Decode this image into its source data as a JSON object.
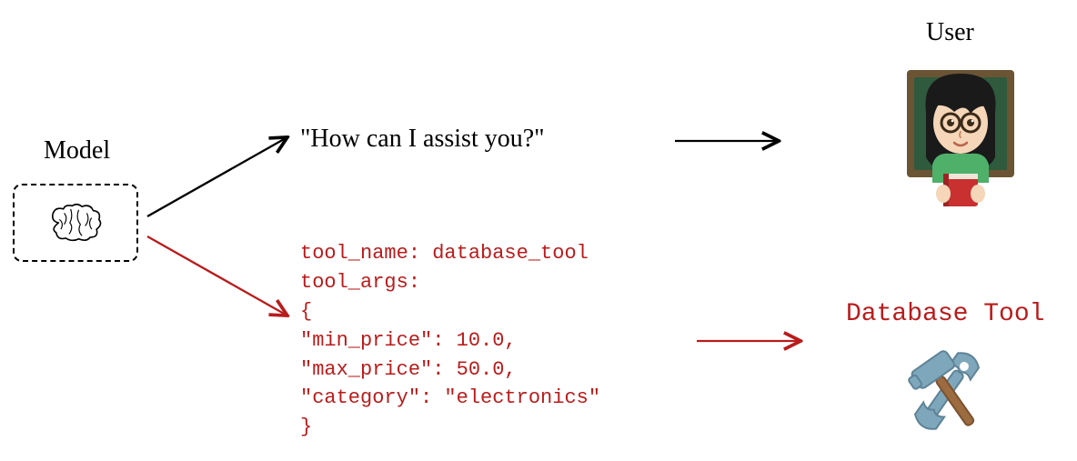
{
  "labels": {
    "model": "Model",
    "user": "User",
    "database_tool": "Database Tool"
  },
  "messages": {
    "assistant_prompt": "\"How can I assist you?\""
  },
  "tool_call": {
    "lines": "tool_name: database_tool\ntool_args:\n{\n\"min_price\": 10.0,\n\"max_price\": 50.0,\n\"category\": \"electronics\"\n}",
    "tool_name": "database_tool",
    "tool_args": {
      "min_price": 10.0,
      "max_price": 50.0,
      "category": "electronics"
    }
  },
  "icons": {
    "model": "brain-icon",
    "user": "teacher-avatar-icon",
    "database_tool": "hammer-wrench-icon"
  },
  "arrows": [
    {
      "from": "model",
      "to": "assistant_prompt",
      "color": "black"
    },
    {
      "from": "assistant_prompt",
      "to": "user",
      "color": "black"
    },
    {
      "from": "model",
      "to": "tool_call",
      "color": "red"
    },
    {
      "from": "tool_call",
      "to": "database_tool",
      "color": "red"
    }
  ]
}
